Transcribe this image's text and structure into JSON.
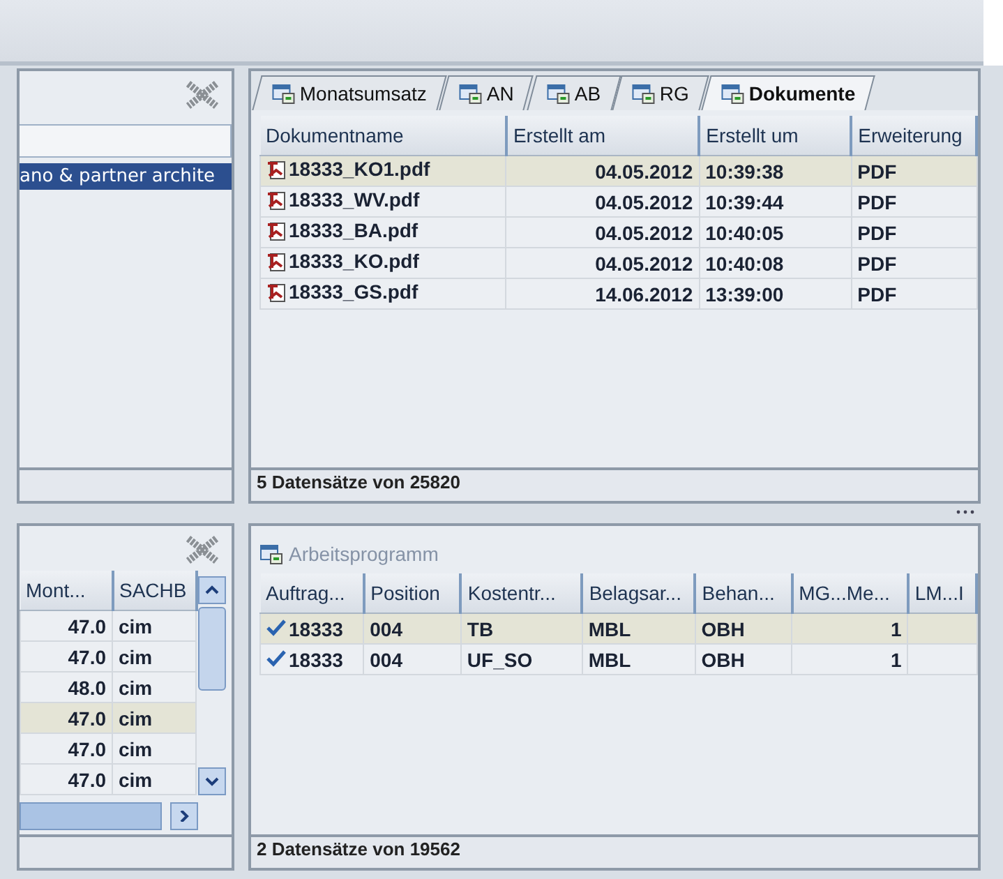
{
  "left_top_panel": {
    "list_items": [
      {
        "label": "ano & partner archite",
        "selected": true
      }
    ]
  },
  "documents_panel": {
    "tabs": [
      {
        "label": "Monatsumsatz",
        "selected": false
      },
      {
        "label": "AN",
        "selected": false
      },
      {
        "label": "AB",
        "selected": false
      },
      {
        "label": "RG",
        "selected": false
      },
      {
        "label": "Dokumente",
        "selected": true
      }
    ],
    "table": {
      "columns": [
        "Dokumentname",
        "Erstellt am",
        "Erstellt um",
        "Erweiterung"
      ],
      "rows": [
        {
          "cells": [
            "18333_KO1.pdf",
            "04.05.2012",
            "10:39:38",
            "PDF"
          ],
          "selected": true
        },
        {
          "cells": [
            "18333_WV.pdf",
            "04.05.2012",
            "10:39:44",
            "PDF"
          ],
          "selected": false
        },
        {
          "cells": [
            "18333_BA.pdf",
            "04.05.2012",
            "10:40:05",
            "PDF"
          ],
          "selected": false
        },
        {
          "cells": [
            "18333_KO.pdf",
            "04.05.2012",
            "10:40:08",
            "PDF"
          ],
          "selected": false
        },
        {
          "cells": [
            "18333_GS.pdf",
            "14.06.2012",
            "13:39:00",
            "PDF"
          ],
          "selected": false
        }
      ]
    },
    "status": "5 Datensätze von 25820"
  },
  "left_bottom_panel": {
    "table": {
      "columns": [
        "Mont...",
        "SACHB"
      ],
      "rows": [
        {
          "cells": [
            "47.0",
            "cim"
          ],
          "selected": false
        },
        {
          "cells": [
            "47.0",
            "cim"
          ],
          "selected": false
        },
        {
          "cells": [
            "48.0",
            "cim"
          ],
          "selected": false
        },
        {
          "cells": [
            "47.0",
            "cim"
          ],
          "selected": true
        },
        {
          "cells": [
            "47.0",
            "cim"
          ],
          "selected": false
        },
        {
          "cells": [
            "47.0",
            "cim"
          ],
          "selected": false
        }
      ]
    }
  },
  "work_panel": {
    "title": "Arbeitsprogramm",
    "table": {
      "columns": [
        "Auftrag...",
        "Position",
        "Kostentr...",
        "Belagsar...",
        "Behan...",
        "MG...Me...",
        "LM...I"
      ],
      "rows": [
        {
          "checked": true,
          "cells": [
            "18333",
            "004",
            "TB",
            "MBL",
            "OBH",
            "1",
            ""
          ],
          "selected": true
        },
        {
          "checked": true,
          "cells": [
            "18333",
            "004",
            "UF_SO",
            "MBL",
            "OBH",
            "1",
            ""
          ],
          "selected": false
        }
      ]
    },
    "status": "2 Datensätze von 19562"
  }
}
